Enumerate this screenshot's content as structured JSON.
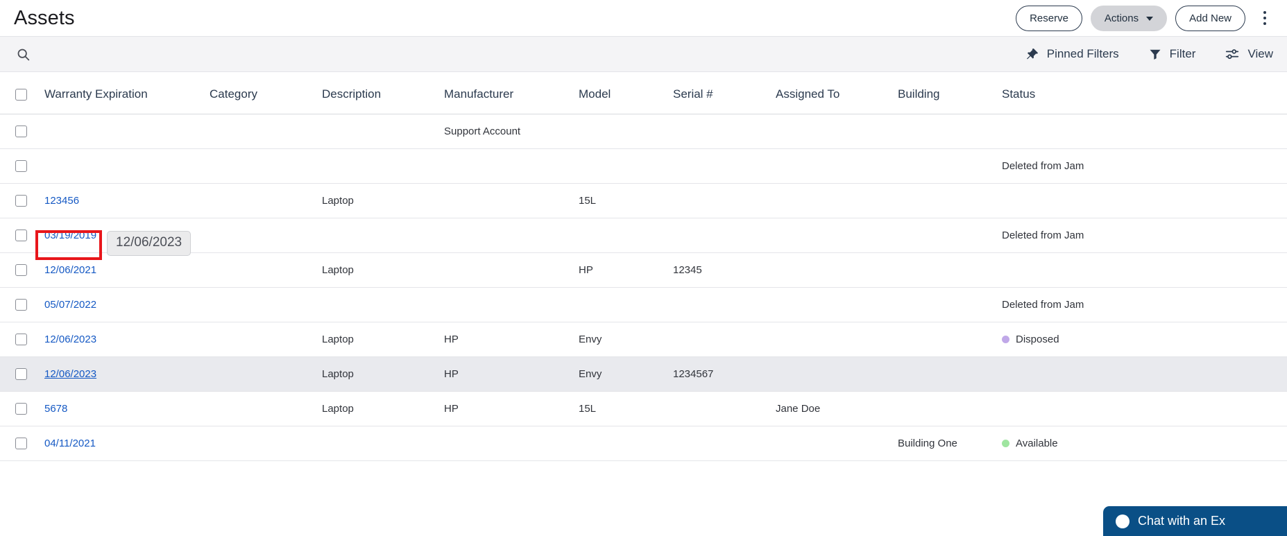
{
  "header": {
    "title": "Assets",
    "buttons": [
      {
        "label": "Reserve",
        "style": "outline",
        "name": "reserve-button"
      },
      {
        "label": "Actions",
        "style": "filled",
        "name": "actions-button",
        "has_chevron": true
      },
      {
        "label": "Add New",
        "style": "outline",
        "name": "add-new-button"
      }
    ],
    "overflow_menu_icon": "kebab-menu-icon"
  },
  "toolbar": {
    "search_icon": "search-icon",
    "items": [
      {
        "label": "Pinned Filters",
        "icon": "pin-icon",
        "name": "pinned-filters-button"
      },
      {
        "label": "Filter",
        "icon": "funnel-icon",
        "name": "filter-button"
      },
      {
        "label": "View",
        "icon": "sliders-icon",
        "name": "view-button"
      }
    ]
  },
  "table": {
    "select_all_name": "select-all-checkbox",
    "columns": [
      "Warranty Expiration",
      "Category",
      "Description",
      "Manufacturer",
      "Model",
      "Serial #",
      "Assigned To",
      "Building",
      "Status"
    ],
    "rows": [
      {
        "warranty": "",
        "category": "",
        "description": "",
        "manufacturer": "Support Account",
        "model": "",
        "serial": "",
        "assigned_to": "",
        "building": "",
        "status": "",
        "status_color": "",
        "hovered": false
      },
      {
        "warranty": "",
        "category": "",
        "description": "",
        "manufacturer": "",
        "model": "",
        "serial": "",
        "assigned_to": "",
        "building": "",
        "status": "Deleted from Jam",
        "status_color": "",
        "hovered": false
      },
      {
        "warranty": "123456",
        "category": "",
        "description": "Laptop",
        "manufacturer": "",
        "model": "15L",
        "serial": "",
        "assigned_to": "",
        "building": "",
        "status": "",
        "status_color": "",
        "hovered": false
      },
      {
        "warranty": "03/19/2019",
        "category": "",
        "description": "",
        "manufacturer": "",
        "model": "",
        "serial": "",
        "assigned_to": "",
        "building": "",
        "status": "Deleted from Jam",
        "status_color": "",
        "hovered": false
      },
      {
        "warranty": "12/06/2021",
        "category": "",
        "description": "Laptop",
        "manufacturer": "",
        "model": "HP",
        "serial": "12345",
        "assigned_to": "",
        "building": "",
        "status": "",
        "status_color": "",
        "hovered": false
      },
      {
        "warranty": "05/07/2022",
        "category": "",
        "description": "",
        "manufacturer": "",
        "model": "",
        "serial": "",
        "assigned_to": "",
        "building": "",
        "status": "Deleted from Jam",
        "status_color": "",
        "hovered": false
      },
      {
        "warranty": "12/06/2023",
        "category": "",
        "description": "Laptop",
        "manufacturer": "HP",
        "model": "Envy",
        "serial": "",
        "assigned_to": "",
        "building": "",
        "status": "Disposed",
        "status_color": "#c0a8e8",
        "hovered": false
      },
      {
        "warranty": "12/06/2023",
        "category": "",
        "description": "Laptop",
        "manufacturer": "HP",
        "model": "Envy",
        "serial": "1234567",
        "assigned_to": "",
        "building": "",
        "status": "",
        "status_color": "",
        "hovered": true
      },
      {
        "warranty": "5678",
        "category": "",
        "description": "Laptop",
        "manufacturer": "HP",
        "model": "15L",
        "serial": "",
        "assigned_to": "Jane Doe",
        "building": "",
        "status": "",
        "status_color": "",
        "hovered": false
      },
      {
        "warranty": "04/11/2021",
        "category": "",
        "description": "",
        "manufacturer": "",
        "model": "",
        "serial": "",
        "assigned_to": "",
        "building": "Building One",
        "status": "Available",
        "status_color": "#9fe5a0",
        "hovered": false
      }
    ]
  },
  "tooltip": {
    "text": "12/06/2023"
  },
  "annotation": {
    "color": "#e8161b"
  },
  "chat": {
    "label": "Chat with an Ex",
    "icon": "chat-dot-icon"
  },
  "colors": {
    "link": "#1559c4",
    "header_text": "#2b3a4e",
    "toolbar_bg": "#f4f4f6",
    "row_hover_bg": "#e9eaee",
    "chat_bg": "#0a4f86"
  }
}
